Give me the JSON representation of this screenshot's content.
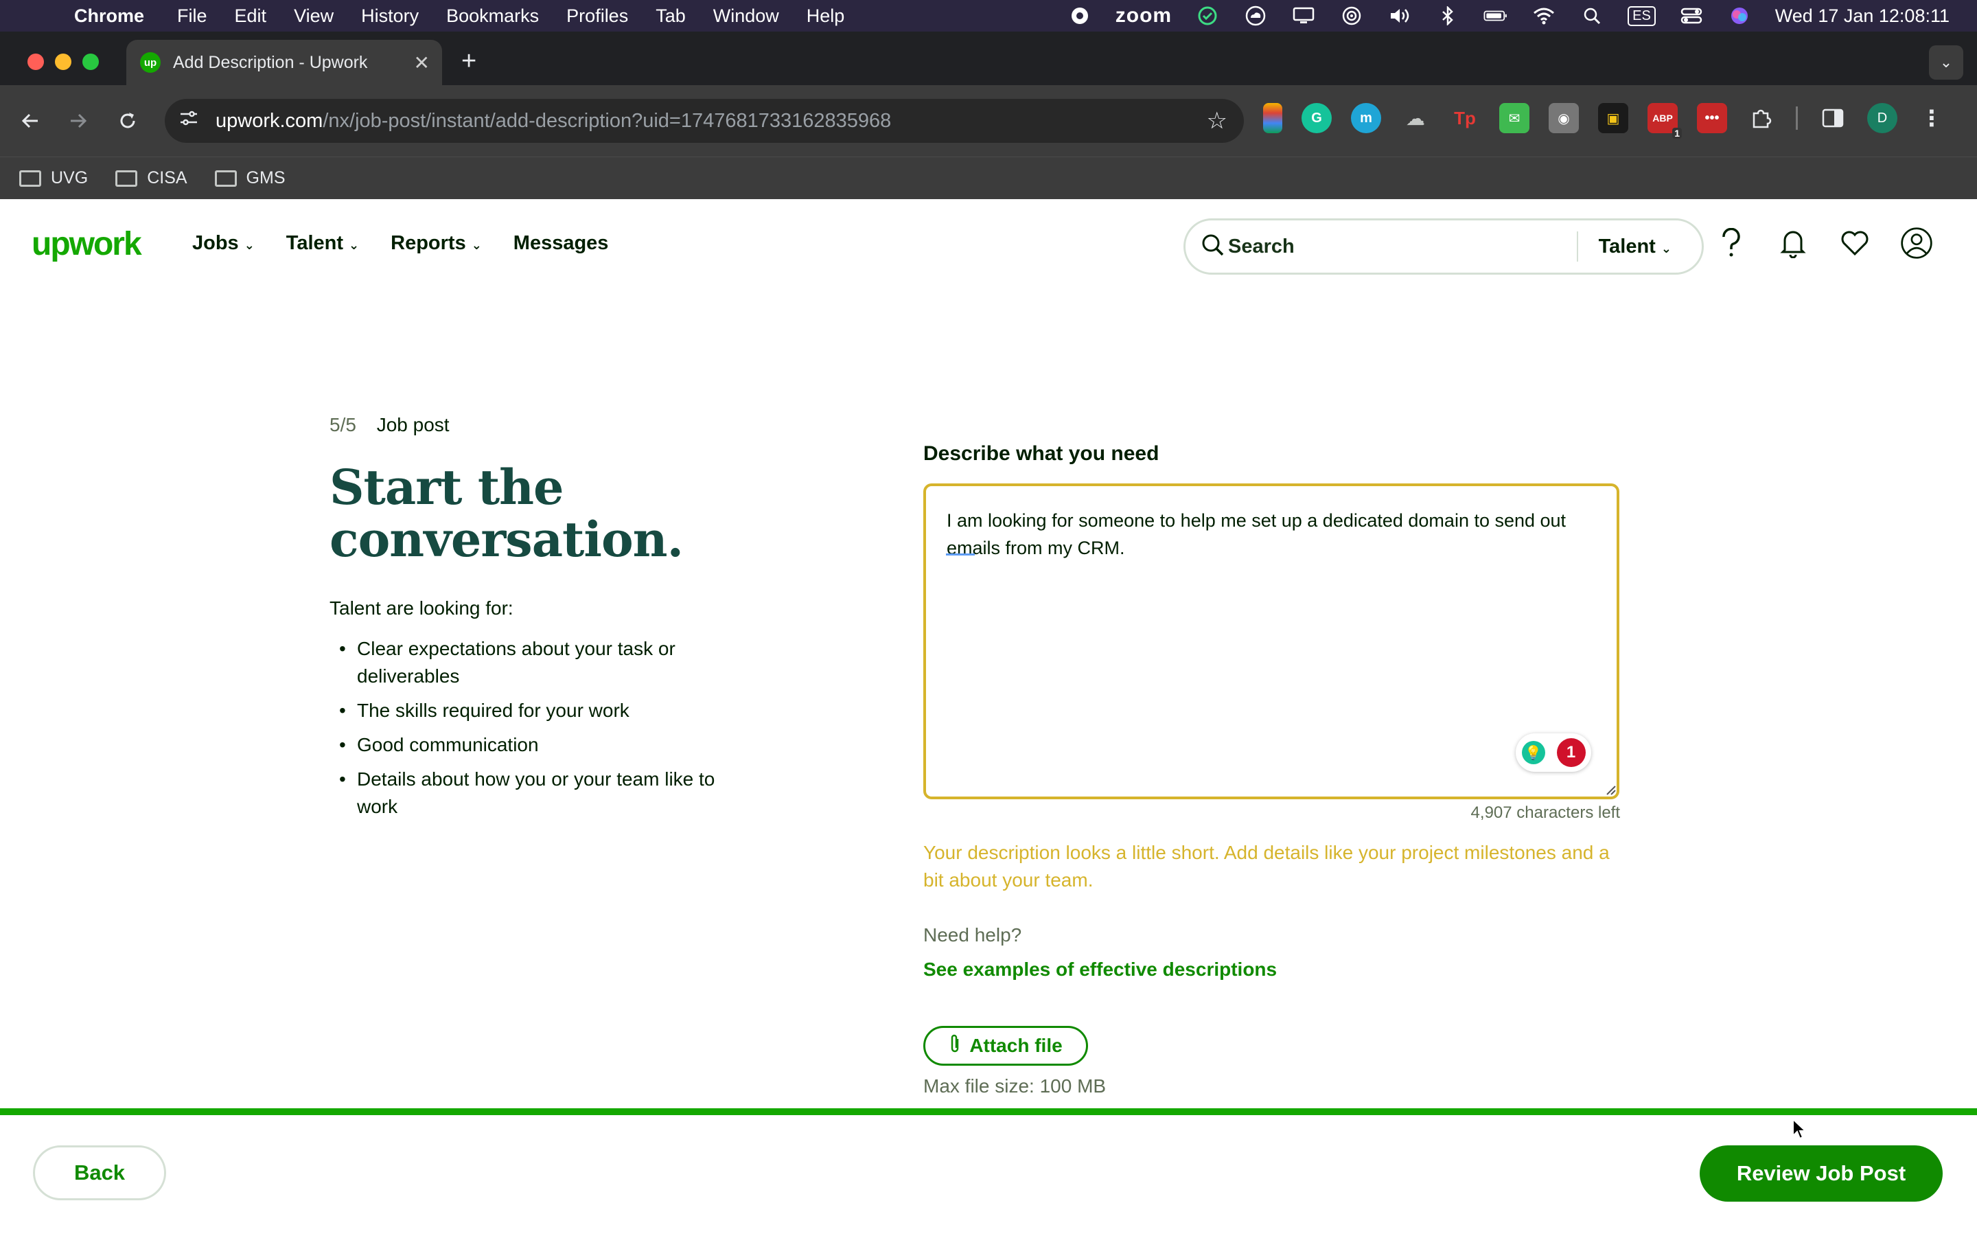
{
  "menubar": {
    "app_name": "Chrome",
    "items": [
      "File",
      "Edit",
      "View",
      "History",
      "Bookmarks",
      "Profiles",
      "Tab",
      "Window",
      "Help"
    ],
    "zoom_label": "zoom",
    "input_source": "ES",
    "clock": "Wed 17 Jan  12:08:11"
  },
  "browser": {
    "tab_title": "Add Description - Upwork",
    "tab_favicon_text": "up",
    "url_host": "upwork.com",
    "url_path": "/nx/job-post/instant/add-description?uid=1747681733162835968",
    "profile_initial": "D",
    "ext_badge": "1",
    "bookmarks": [
      "UVG",
      "CISA",
      "GMS"
    ]
  },
  "header": {
    "logo": "upwork",
    "nav": [
      "Jobs",
      "Talent",
      "Reports",
      "Messages"
    ],
    "search_label": "Search",
    "search_scope": "Talent"
  },
  "left": {
    "step": "5/5",
    "step_label": "Job post",
    "headline": "Start the conversation.",
    "lead": "Talent are looking for:",
    "bullets": [
      "Clear expectations about your task or deliverables",
      "The skills required for your work",
      "Good communication",
      "Details about how you or your team like to work"
    ]
  },
  "form": {
    "label": "Describe what you need",
    "description_value": "I am looking for someone to help me set up a dedicated domain to send out emails from my CRM.",
    "grammarly_count": "1",
    "chars_left": "4,907 characters left",
    "warning": "Your description looks a little short. Add details like your project milestones and a bit about your team.",
    "need_help": "Need help?",
    "examples_link": "See examples of effective descriptions",
    "attach_label": "Attach file",
    "max_size": "Max file size: 100 MB"
  },
  "footer": {
    "progress": 1.0,
    "back_label": "Back",
    "review_label": "Review Job Post"
  },
  "colors": {
    "brand_green": "#14a800",
    "button_green": "#108a00",
    "headline": "#164a41",
    "warning": "#d6b42c"
  }
}
